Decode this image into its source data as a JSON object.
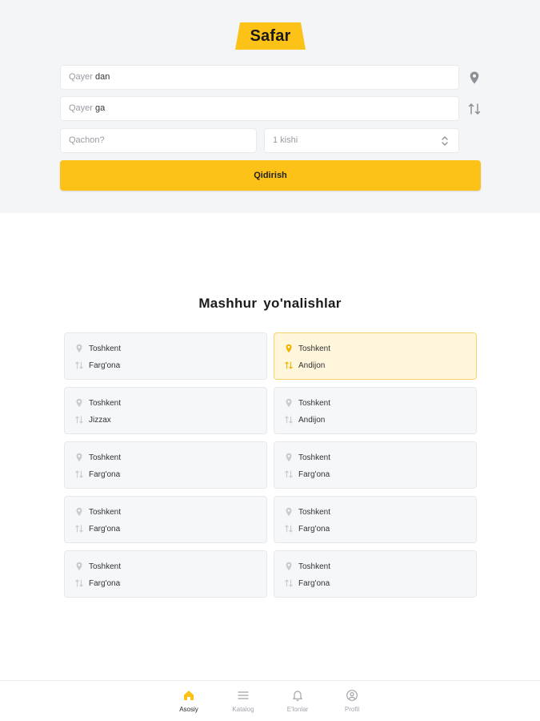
{
  "brand": {
    "name": "Safar",
    "color": "#fdc218"
  },
  "search": {
    "from": {
      "prefix": "Qayer",
      "suffix": "dan",
      "icon": "location-pin-icon"
    },
    "to": {
      "prefix": "Qayer",
      "suffix": "ga",
      "icon": "swap-icon"
    },
    "date_placeholder": "Qachon?",
    "passengers_value": "1 kishi",
    "submit_label": "Qidirish"
  },
  "popular": {
    "title": "Mashhur yo'nalishlar",
    "routes": [
      {
        "from": "Toshkent",
        "to": "Farg'ona",
        "active": false
      },
      {
        "from": "Toshkent",
        "to": "Andijon",
        "active": true
      },
      {
        "from": "Toshkent",
        "to": "Jizzax",
        "active": false
      },
      {
        "from": "Toshkent",
        "to": "Andijon",
        "active": false
      },
      {
        "from": "Toshkent",
        "to": "Farg'ona",
        "active": false
      },
      {
        "from": "Toshkent",
        "to": "Farg'ona",
        "active": false
      },
      {
        "from": "Toshkent",
        "to": "Farg'ona",
        "active": false
      },
      {
        "from": "Toshkent",
        "to": "Farg'ona",
        "active": false
      },
      {
        "from": "Toshkent",
        "to": "Farg'ona",
        "active": false
      },
      {
        "from": "Toshkent",
        "to": "Farg'ona",
        "active": false
      }
    ]
  },
  "nav": {
    "items": [
      {
        "label": "Asosiy",
        "icon": "home-icon",
        "active": true
      },
      {
        "label": "Katalog",
        "icon": "menu-icon",
        "active": false
      },
      {
        "label": "E'lonlar",
        "icon": "bell-icon",
        "active": false
      },
      {
        "label": "Profil",
        "icon": "user-icon",
        "active": false
      }
    ]
  },
  "colors": {
    "accent": "#fdc218",
    "header_bg": "#f4f5f7",
    "active_card": "#fff6dc"
  }
}
